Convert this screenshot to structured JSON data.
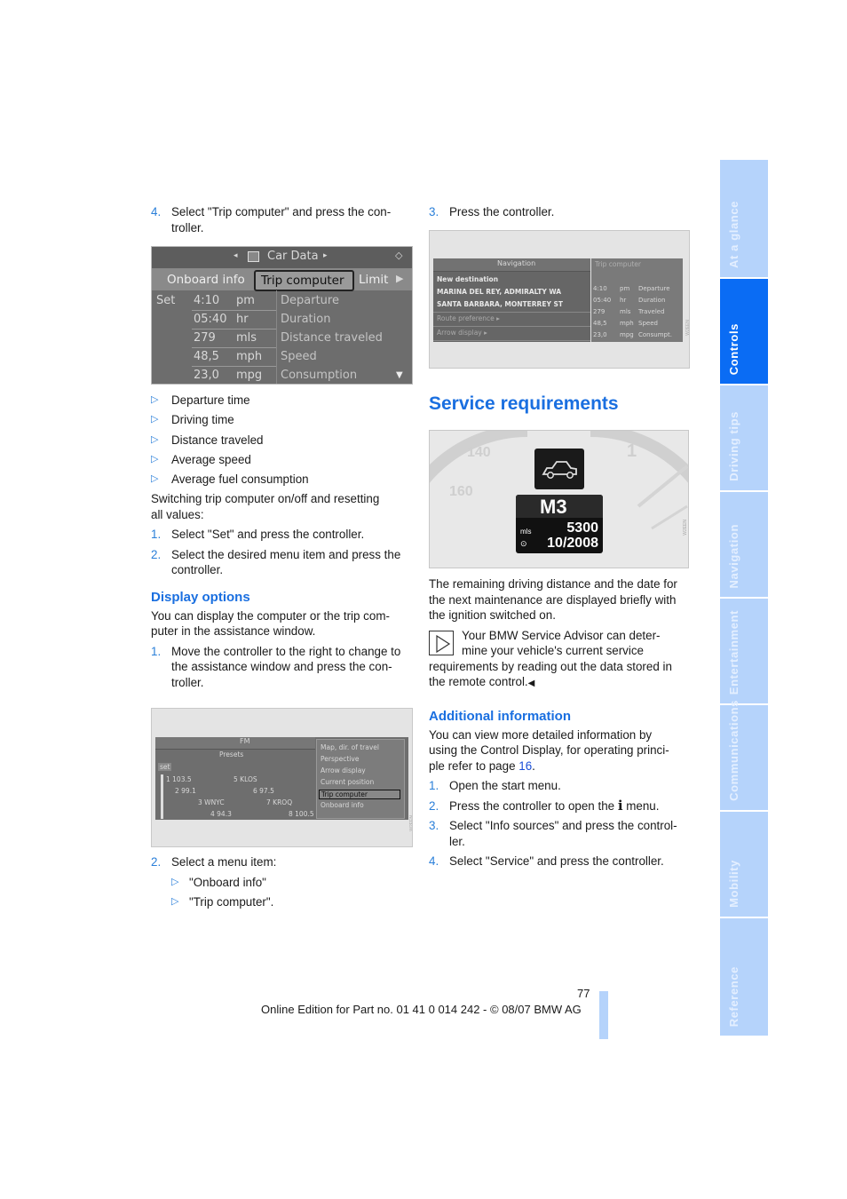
{
  "left_column": {
    "step4": {
      "num": "4.",
      "text_line1": "Select \"Trip computer\" and press the con-",
      "text_line2": "troller."
    },
    "trip_screen": {
      "header": "Car Data",
      "tabs": [
        "Onboard info",
        "Trip computer",
        "Limit"
      ],
      "selected_tab": "Trip computer",
      "set_label": "Set",
      "rows": [
        {
          "value": "4:10",
          "unit": "pm",
          "label": "Departure"
        },
        {
          "value": "05:40",
          "unit": "hr",
          "label": "Duration"
        },
        {
          "value": "279",
          "unit": "mls",
          "label": "Distance traveled"
        },
        {
          "value": "48,5",
          "unit": "mph",
          "label": "Speed"
        },
        {
          "value": "23,0",
          "unit": "mpg",
          "label": "Consumption"
        }
      ]
    },
    "bullets": [
      "Departure time",
      "Driving time",
      "Distance traveled",
      "Average speed",
      "Average fuel consumption"
    ],
    "switching_text_l1": "Switching trip computer on/off and resetting",
    "switching_text_l2": "all values:",
    "reset_steps": [
      {
        "num": "1.",
        "l1": "Select \"Set\" and press the controller.",
        "l2": ""
      },
      {
        "num": "2.",
        "l1": "Select the desired menu item and press the",
        "l2": "controller."
      }
    ],
    "display_options": {
      "heading": "Display options",
      "intro_l1": "You can display the computer or the trip com-",
      "intro_l2": "puter in the assistance window.",
      "step1": {
        "num": "1.",
        "l1": "Move the controller to the right to change to",
        "l2": "the assistance window and press the con-",
        "l3": "troller."
      },
      "radio_screen": {
        "header": "FM",
        "presets": "Presets",
        "set_label": "set",
        "stations": [
          "1 103.5",
          "5 KLOS",
          "2 99.1",
          "6 97.5",
          "3 WNYC",
          "7 KROQ",
          "4 94.3",
          "8 100.5"
        ],
        "menu": [
          "Map, dir. of travel",
          "Perspective",
          "Arrow display",
          "Current position",
          "Trip computer",
          "Onboard info"
        ],
        "selected": "Trip computer"
      },
      "step2": {
        "num": "2.",
        "text": "Select a menu item:"
      },
      "sub_items": [
        "\"Onboard info\"",
        "\"Trip computer\"."
      ]
    }
  },
  "right_column": {
    "step3": {
      "num": "3.",
      "text": "Press the controller."
    },
    "nav_screen": {
      "header": "Navigation",
      "items": [
        "New destination",
        "MARINA DEL REY, ADMIRALTY WA",
        "SANTA BARBARA, MONTERREY ST",
        "Route preference",
        "Arrow display"
      ],
      "assist_title": "Trip computer",
      "assist_rows": [
        {
          "value": "4:10",
          "unit": "pm",
          "label": "Departure"
        },
        {
          "value": "05:40",
          "unit": "hr",
          "label": "Duration"
        },
        {
          "value": "279",
          "unit": "mls",
          "label": "Traveled"
        },
        {
          "value": "48,5",
          "unit": "mph",
          "label": "Speed"
        },
        {
          "value": "23,0",
          "unit": "mpg",
          "label": "Consumpt."
        }
      ]
    },
    "service": {
      "heading": "Service requirements",
      "cluster": {
        "model": "M3",
        "unit": "mls",
        "distance": "5300",
        "date": "10/2008",
        "gauge_labels": [
          "140",
          "160",
          "1"
        ]
      },
      "desc_l1": "The remaining driving distance and the date for",
      "desc_l2": "the next maintenance are displayed briefly with",
      "desc_l3": "the ignition switched on.",
      "note_l1": "Your BMW Service Advisor can deter-",
      "note_l2": "mine your vehicle's current service",
      "note_l3": "requirements by reading out the data stored in",
      "note_l4": "the remote control.",
      "note_end": "◀"
    },
    "additional": {
      "heading": "Additional information",
      "intro_l1": "You can view more detailed information by",
      "intro_l2": "using the Control Display, for operating princi-",
      "intro_l3_pre": "ple refer to page ",
      "intro_l3_link": "16",
      "intro_l3_post": ".",
      "steps": [
        {
          "num": "1.",
          "l1": "Open the start menu.",
          "l2": ""
        },
        {
          "num": "2.",
          "l1_pre": "Press the controller to open the ",
          "l1_icon": "i",
          "l1_post": " menu.",
          "l2": ""
        },
        {
          "num": "3.",
          "l1": "Select \"Info sources\" and press the control-",
          "l2": "ler."
        },
        {
          "num": "4.",
          "l1": "Select \"Service\" and press the controller.",
          "l2": ""
        }
      ]
    }
  },
  "side_tabs": [
    {
      "label": "At a glance",
      "active": false
    },
    {
      "label": "Controls",
      "active": true
    },
    {
      "label": "Driving tips",
      "active": false
    },
    {
      "label": "Navigation",
      "active": false
    },
    {
      "label": "Entertainment",
      "active": false
    },
    {
      "label": "Communications",
      "active": false
    },
    {
      "label": "Mobility",
      "active": false
    },
    {
      "label": "Reference",
      "active": false
    }
  ],
  "footer": {
    "page_number": "77",
    "edition": "Online Edition for Part no. 01 41 0 014 242 - © 08/07 BMW AG"
  },
  "colors": {
    "accent": "#1a6fe0",
    "tab_active": "#0a6cf4",
    "tab_inactive": "#b5d3fb"
  }
}
